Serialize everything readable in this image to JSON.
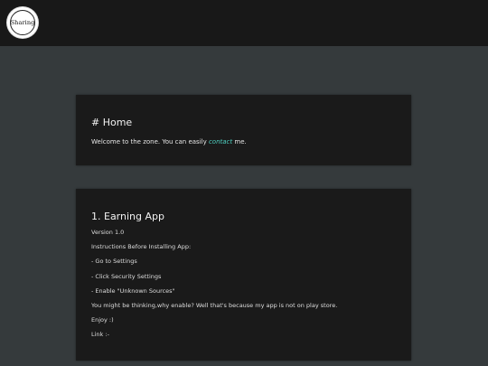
{
  "header": {
    "logo_text": "Sharing"
  },
  "home_card": {
    "title": "# Home",
    "text_before": "Welcome to the zone. You can easily ",
    "link_text": "contact",
    "text_after": " me."
  },
  "app_card": {
    "title": "1. Earning App",
    "lines": [
      "Version 1.0",
      "Instructions Before Installing App:",
      "- Go to Settings",
      "- Click Security Settings",
      "- Enable \"Unknown Sources\"",
      "You might be thinking,why enable? Well that's because my app is not on play store.",
      "Enjoy :)",
      "Link :-"
    ]
  }
}
